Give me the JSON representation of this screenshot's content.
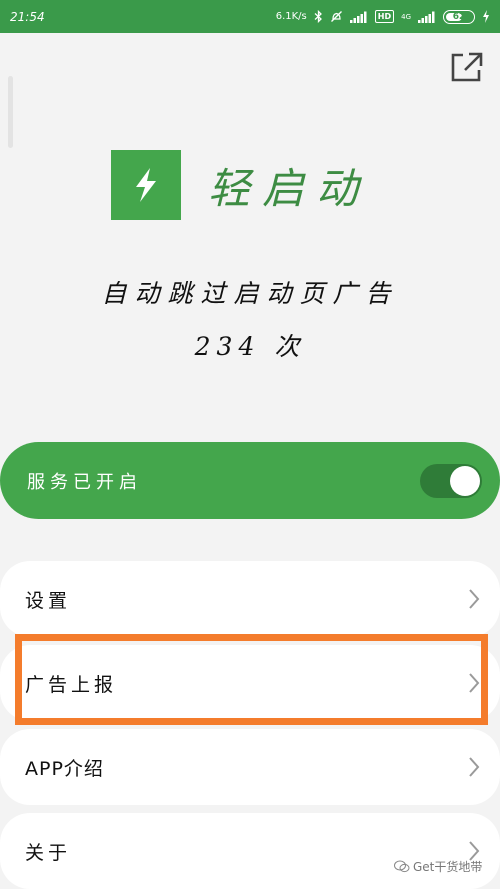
{
  "status_bar": {
    "time": "21:54",
    "net_speed": "6.1K/s",
    "hd": "HD",
    "net_type": "4G",
    "battery": "62"
  },
  "app": {
    "name": "轻启动"
  },
  "stats": {
    "description": "自动跳过启动页广告",
    "count": "234 次"
  },
  "service": {
    "label": "服务已开启",
    "enabled": true
  },
  "menu": {
    "settings": "设置",
    "ad_report": "广告上报",
    "app_intro": "APP介绍",
    "about": "关于"
  },
  "watermark": {
    "text": "Get干货地带"
  },
  "colors": {
    "brand_green": "#44a64c",
    "status_green": "#3a9a4a",
    "highlight_orange": "#f47c2c"
  }
}
